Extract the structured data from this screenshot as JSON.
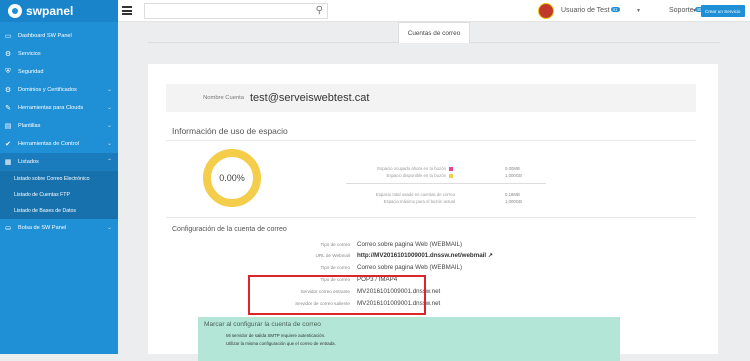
{
  "brand": "swpanel",
  "sidebar": {
    "items": [
      {
        "icon": "dashboard-icon",
        "label": "Dashboard SW Panel"
      },
      {
        "icon": "services-icon",
        "label": "Servicios"
      },
      {
        "icon": "security-icon",
        "label": "Seguridad"
      },
      {
        "icon": "domains-icon",
        "label": "Dominios y Certificados",
        "chev": "⌄"
      },
      {
        "icon": "cloud-icon",
        "label": "Herramientas para Clouds",
        "chev": "⌄"
      },
      {
        "icon": "templates-icon",
        "label": "Plantillas",
        "chev": "⌄"
      },
      {
        "icon": "control-icon",
        "label": "Herramientas de Control",
        "chev": "⌄"
      },
      {
        "icon": "list-icon",
        "label": "Listados",
        "chev": "⌃"
      }
    ],
    "subitems": [
      "Listado sobre Correo Electrónico",
      "Listado de Cuentas FTP",
      "Listado de Bases de Datos"
    ],
    "bottom": {
      "icon": "bag-icon",
      "label": "Bolsa de SW Panel",
      "chev": "⌄"
    }
  },
  "topbar": {
    "user": "Usuario de Test",
    "user_badge": "41",
    "support": "Soporte",
    "support_badge": "456",
    "create": "Crear un Servicio"
  },
  "tab": "Cuentas de correo",
  "account": {
    "label": "Nombre Cuenta",
    "value": "test@serveiswebtest.cat"
  },
  "usage": {
    "title": "Información de uso de espacio",
    "percent": "0.00%",
    "stats": [
      {
        "label": "Espacio ocupado ahora en tu buzón",
        "value": "0,00MB",
        "color": "#e84393"
      },
      {
        "label": "Espacio disponible en tu buzón",
        "value": "1,000GB",
        "color": "#f4cd4b"
      },
      {
        "label": "Espacio total usado en cuentas de correo",
        "value": "0,18MB"
      },
      {
        "label": "Espacio máximo para el buzón actual",
        "value": "1,000GB"
      }
    ]
  },
  "config": {
    "title": "Configuración de la cuenta de correo",
    "rows": [
      {
        "label": "Tipo de correo",
        "value": "Correo sobre pagina Web (WEBMAIL)"
      },
      {
        "label": "URL de Webmail",
        "value": "http://MV2016101009001.dnssw.net/webmail"
      },
      {
        "label": "Tipo de correo",
        "value": "Correo sobre pagina Web (WEBMAIL)"
      },
      {
        "label": "Tipo de correo",
        "value": "POP3 / IMAP4"
      },
      {
        "label": "Servidor correo entrante",
        "value": "MV2016101009001.dnssw.net"
      },
      {
        "label": "Servidor de correo saliente",
        "value": "MV2016101009001.dnssw.net"
      }
    ]
  },
  "notice": {
    "title": "Marcar al configurar la cuenta de correo",
    "lines": [
      "Mi servidor de salida SMTP requiere autenticación.",
      "Utilizar la misma configuración que el correo de entrada."
    ]
  }
}
